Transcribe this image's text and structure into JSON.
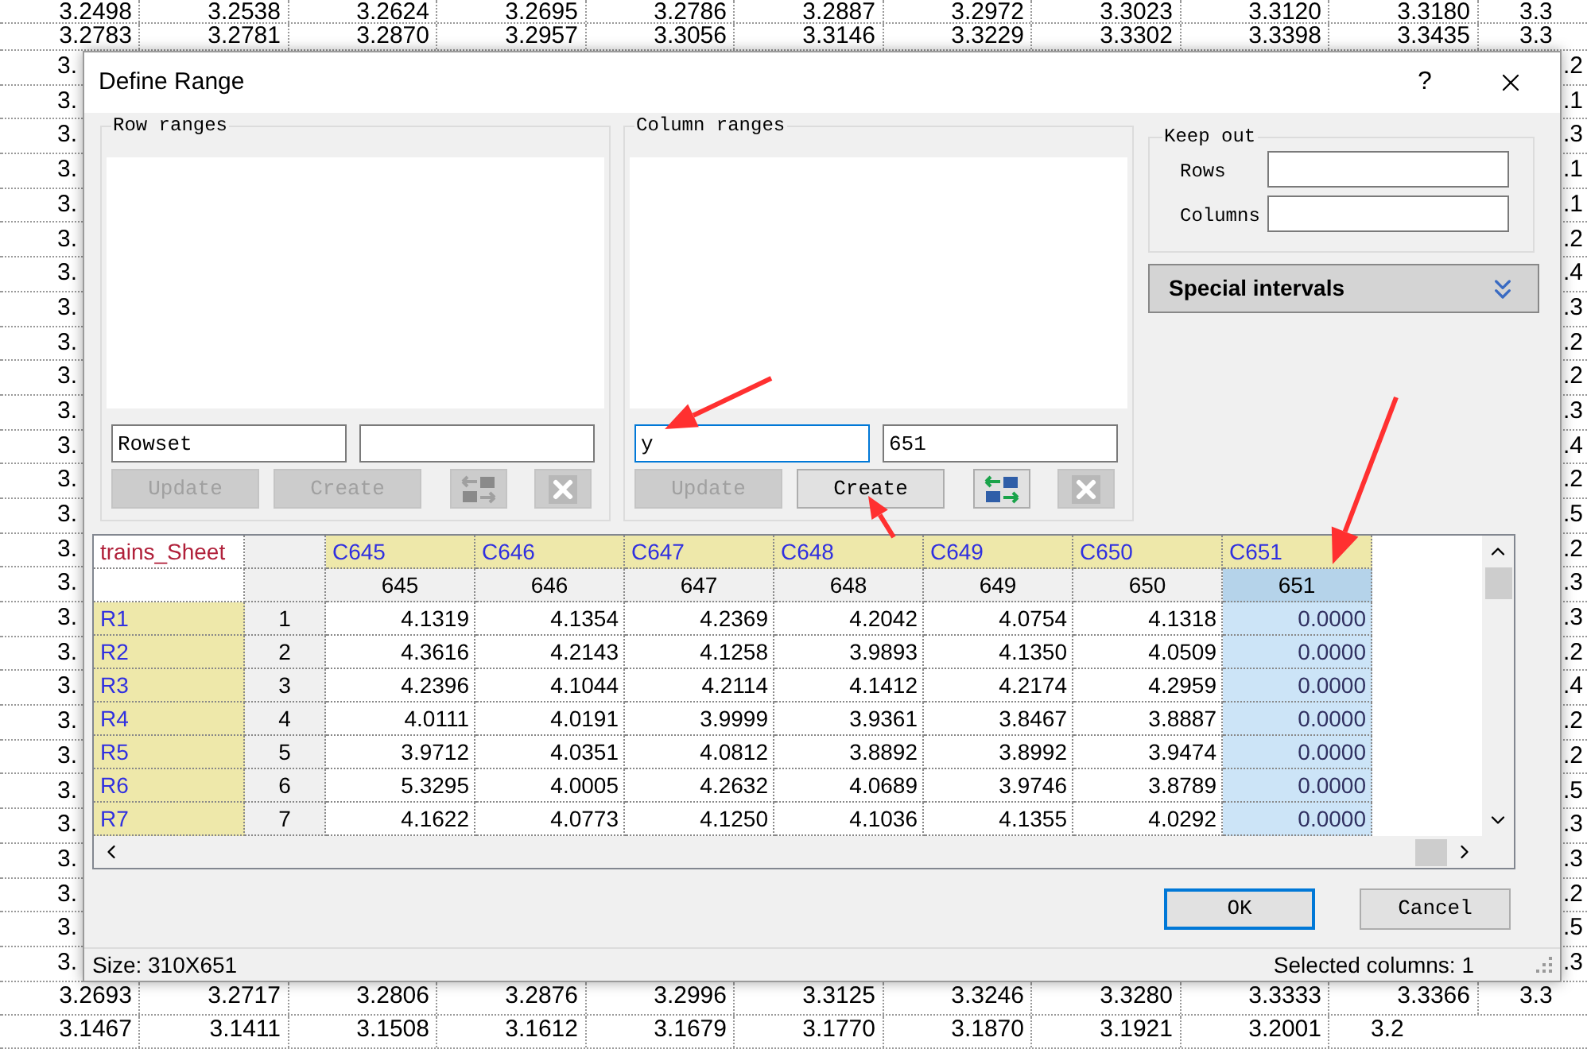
{
  "sheet": {
    "rows": [
      {
        "cells": [
          "3.2498",
          "3.2538",
          "3.2624",
          "3.2695",
          "3.2786",
          "3.2887",
          "3.2972",
          "3.3023",
          "3.3120",
          "3.3180",
          "3.3"
        ]
      },
      {
        "cells": [
          "3.2783",
          "3.2781",
          "3.2870",
          "3.2957",
          "3.3056",
          "3.3146",
          "3.3229",
          "3.3302",
          "3.3398",
          "3.3435",
          "3.3"
        ]
      },
      {
        "cells": [
          "3.",
          ".2"
        ]
      },
      {
        "cells": [
          "3.",
          ".1"
        ]
      },
      {
        "cells": [
          "3.",
          ".3"
        ]
      },
      {
        "cells": [
          "3.",
          ".1"
        ]
      },
      {
        "cells": [
          "3.",
          ".1"
        ]
      },
      {
        "cells": [
          "3.",
          ".2"
        ]
      },
      {
        "cells": [
          "3.",
          ".4"
        ]
      },
      {
        "cells": [
          "3.",
          ".3"
        ]
      },
      {
        "cells": [
          "3.",
          ".2"
        ]
      },
      {
        "cells": [
          "3.",
          ".2"
        ]
      },
      {
        "cells": [
          "3.",
          ".3"
        ]
      },
      {
        "cells": [
          "3.",
          ".4"
        ]
      },
      {
        "cells": [
          "3.",
          ".2"
        ]
      },
      {
        "cells": [
          "3.",
          ".5"
        ]
      },
      {
        "cells": [
          "3.",
          ".2"
        ]
      },
      {
        "cells": [
          "3.",
          ".3"
        ]
      },
      {
        "cells": [
          "3.",
          ".3"
        ]
      },
      {
        "cells": [
          "3.",
          ".2"
        ]
      },
      {
        "cells": [
          "3.",
          ".4"
        ]
      },
      {
        "cells": [
          "3.",
          ".2"
        ]
      },
      {
        "cells": [
          "3.",
          ".2"
        ]
      },
      {
        "cells": [
          "3.",
          ".5"
        ]
      },
      {
        "cells": [
          "3.",
          ".3"
        ]
      },
      {
        "cells": [
          "3.",
          ".3"
        ]
      },
      {
        "cells": [
          "3.",
          ".2"
        ]
      },
      {
        "cells": [
          "3.",
          ".5"
        ]
      },
      {
        "cells": [
          "3.",
          ".3"
        ]
      },
      {
        "cells": [
          "3.2693",
          "3.2717",
          "3.2806",
          "3.2876",
          "3.2996",
          "3.3125",
          "3.3246",
          "3.3280",
          "3.3333",
          "3.3366",
          "3.3"
        ]
      },
      {
        "cells": [
          "3.1467",
          "3.1411",
          "3.1508",
          "3.1612",
          "3.1679",
          "3.1770",
          "3.1870",
          "3.1921",
          "3.2001",
          "3.2"
        ]
      }
    ]
  },
  "dialog": {
    "title": "Define Range",
    "help": "?",
    "groups": [
      {
        "title": "Row ranges",
        "fields": [
          {
            "value": "Rowset",
            "focused": false
          },
          {
            "focused": false
          }
        ],
        "buttons": [
          {
            "label": "Update",
            "disabled": true
          },
          {
            "label": "Create",
            "disabled": true
          }
        ],
        "icon_buttons": [
          {
            "kind": "swap",
            "disabled": true
          },
          {
            "kind": "delete",
            "disabled": true
          }
        ]
      },
      {
        "title": "Column ranges",
        "fields": [
          {
            "value": "y",
            "focused": true
          },
          {
            "value": "651",
            "focused": false
          }
        ],
        "buttons": [
          {
            "label": "Update",
            "disabled": true
          },
          {
            "label": "Create",
            "disabled": false
          }
        ],
        "icon_buttons": [
          {
            "kind": "swap",
            "disabled": false
          },
          {
            "kind": "delete",
            "disabled": true
          }
        ]
      }
    ],
    "keep_out": {
      "title": "Keep out",
      "fields": [
        {
          "label": "Rows"
        },
        {
          "label": "Columns"
        }
      ]
    },
    "special_intervals": {
      "label": "Special intervals",
      "expanded": false
    },
    "table": {
      "corner": "trains_Sheet",
      "columns": [
        {
          "code": "C645",
          "number": "645",
          "selected": false
        },
        {
          "code": "C646",
          "number": "646",
          "selected": false
        },
        {
          "code": "C647",
          "number": "647",
          "selected": false
        },
        {
          "code": "C648",
          "number": "648",
          "selected": false
        },
        {
          "code": "C649",
          "number": "649",
          "selected": false
        },
        {
          "code": "C650",
          "number": "650",
          "selected": false
        },
        {
          "code": "C651",
          "number": "651",
          "selected": true
        }
      ],
      "rows": [
        {
          "name": "R1",
          "index": "1",
          "values": [
            "4.1319",
            "4.1354",
            "4.2369",
            "4.2042",
            "4.0754",
            "4.1318",
            "0.0000"
          ]
        },
        {
          "name": "R2",
          "index": "2",
          "values": [
            "4.3616",
            "4.2143",
            "4.1258",
            "3.9893",
            "4.1350",
            "4.0509",
            "0.0000"
          ]
        },
        {
          "name": "R3",
          "index": "3",
          "values": [
            "4.2396",
            "4.1044",
            "4.2114",
            "4.1412",
            "4.2174",
            "4.2959",
            "0.0000"
          ]
        },
        {
          "name": "R4",
          "index": "4",
          "values": [
            "4.0111",
            "4.0191",
            "3.9999",
            "3.9361",
            "3.8467",
            "3.8887",
            "0.0000"
          ]
        },
        {
          "name": "R5",
          "index": "5",
          "values": [
            "3.9712",
            "4.0351",
            "4.0812",
            "3.8892",
            "3.8992",
            "3.9474",
            "0.0000"
          ]
        },
        {
          "name": "R6",
          "index": "6",
          "values": [
            "5.3295",
            "4.0005",
            "4.2632",
            "4.0689",
            "3.9746",
            "3.8789",
            "0.0000"
          ]
        },
        {
          "name": "R7",
          "index": "7",
          "values": [
            "4.1622",
            "4.0773",
            "4.1250",
            "4.1036",
            "4.1355",
            "4.0292",
            "0.0000"
          ]
        }
      ]
    },
    "buttons": [
      {
        "label": "OK",
        "default": true
      },
      {
        "label": "Cancel",
        "default": false
      }
    ],
    "status": {
      "size": "Size: 310X651",
      "selection": "Selected columns: 1"
    }
  }
}
